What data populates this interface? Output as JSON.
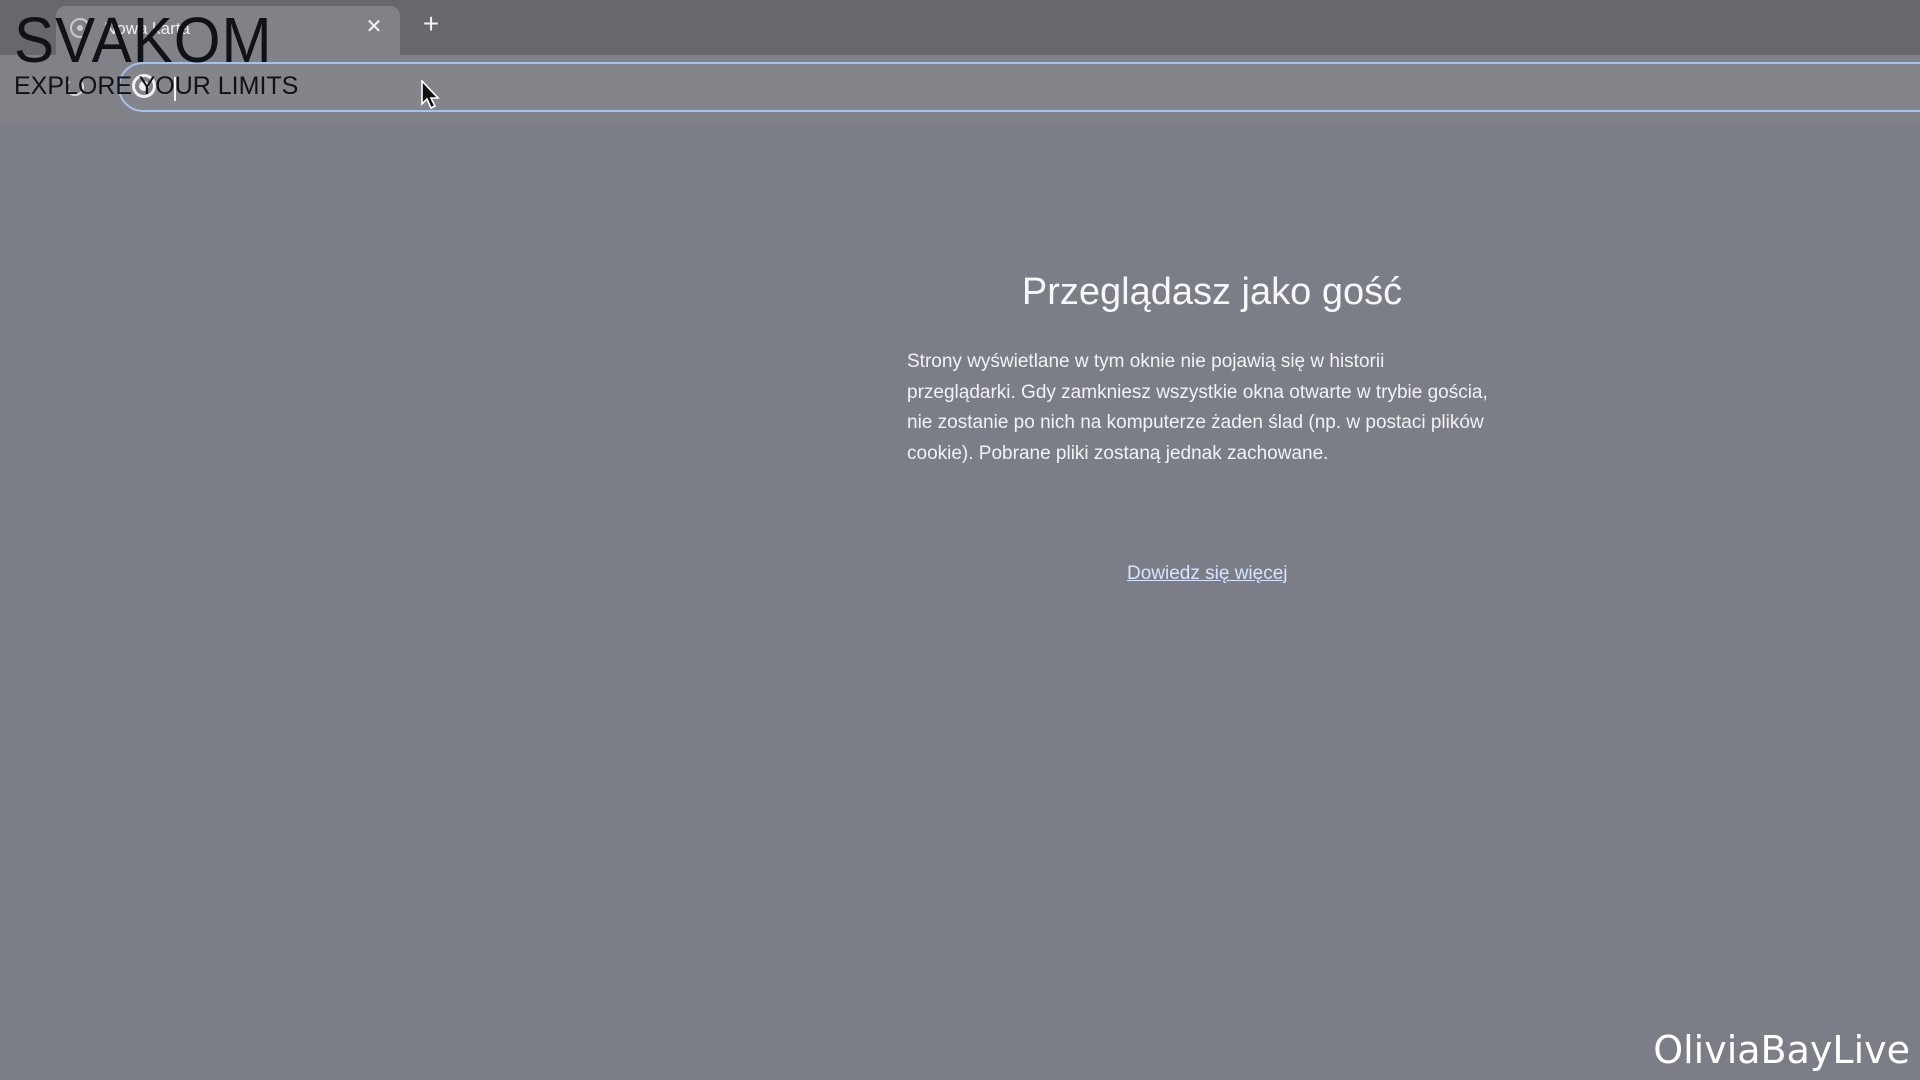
{
  "browser": {
    "tab": {
      "title": "Nowa karta",
      "favicon": "globe-icon",
      "close_icon": "close-icon"
    },
    "new_tab_icon": "plus-icon",
    "toolbar": {
      "reload_icon": "reload-icon",
      "omnibox_icon": "google-icon",
      "omnibox_value": ""
    }
  },
  "content": {
    "heading": "Przeglądasz jako gość",
    "body": "Strony wyświetlane w tym oknie nie pojawią się w historii przeglądarki. Gdy zamkniesz wszystkie okna otwarte w trybie gościa, nie zostanie po nich na komputerze żaden ślad (np. w postaci plików cookie). Pobrane pliki zostaną jednak zachowane.",
    "learn_more": "Dowiedz się więcej"
  },
  "overlay": {
    "brand_name": "SVAKOM",
    "brand_tagline": "EXPLORE YOUR LIMITS",
    "watermark": "OliviaBayLive"
  },
  "colors": {
    "background": "#7c7e87",
    "tab_strip": "#66686e",
    "toolbar": "#808288",
    "omnibox_border": "#a7c1ef",
    "link": "#d7e4ff",
    "text": "#f6f7f8"
  }
}
